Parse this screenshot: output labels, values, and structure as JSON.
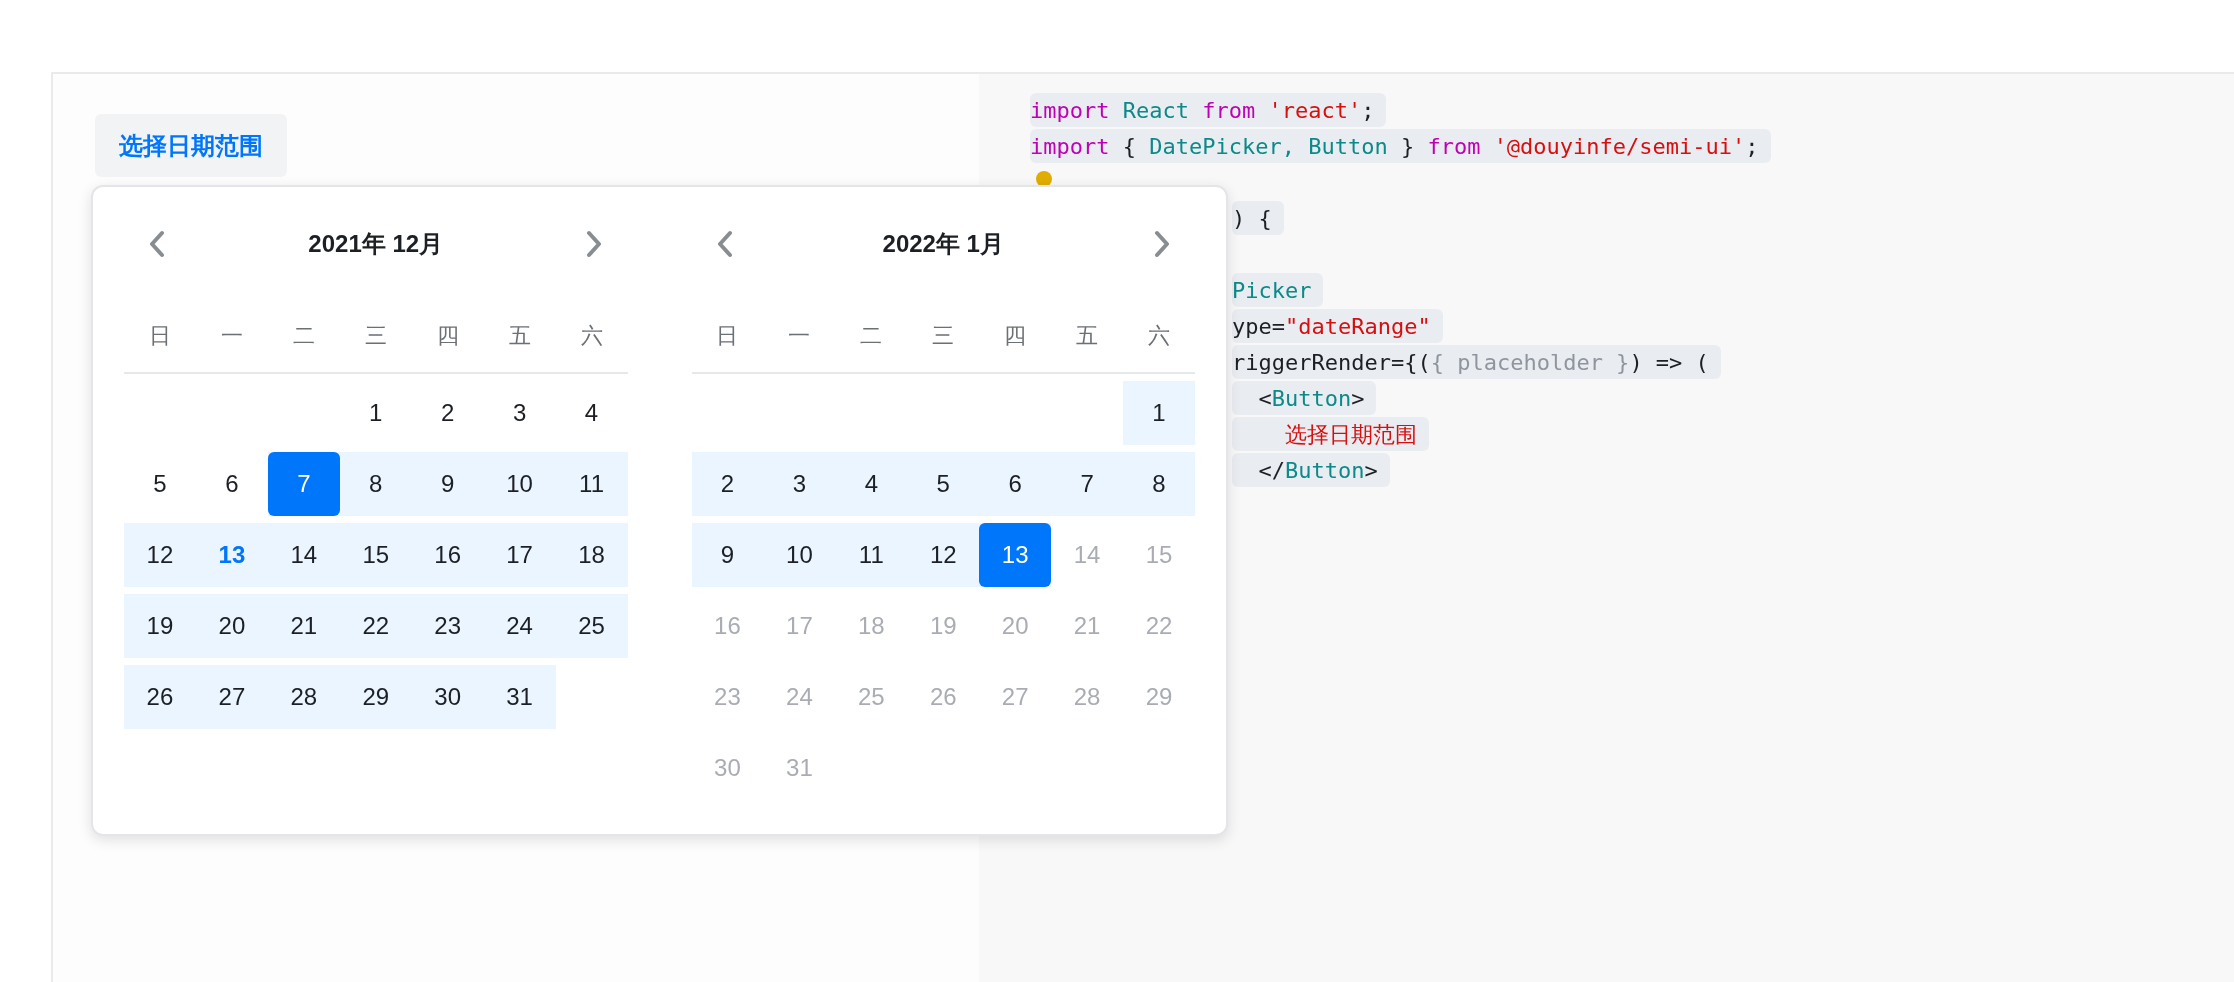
{
  "trigger_button": {
    "label": "选择日期范围"
  },
  "date_picker": {
    "months": [
      {
        "title": "2021年 12月",
        "weekdays": [
          "日",
          "一",
          "二",
          "三",
          "四",
          "五",
          "六"
        ],
        "weeks": [
          [
            {
              "d": "1",
              "selected": false,
              "in_range": false,
              "today": false,
              "disabled": false
            },
            {
              "d": "2",
              "selected": false,
              "in_range": false,
              "today": false,
              "disabled": false
            },
            {
              "d": "3",
              "selected": false,
              "in_range": false,
              "today": false,
              "disabled": false
            },
            {
              "d": "4",
              "selected": false,
              "in_range": false,
              "today": false,
              "disabled": false
            }
          ],
          [
            {
              "d": "5",
              "selected": false,
              "in_range": false,
              "today": false,
              "disabled": false
            },
            {
              "d": "6",
              "selected": false,
              "in_range": false,
              "today": false,
              "disabled": false
            },
            {
              "d": "7",
              "selected": true,
              "in_range": true,
              "today": false,
              "disabled": false
            },
            {
              "d": "8",
              "selected": false,
              "in_range": true,
              "today": false,
              "disabled": false
            },
            {
              "d": "9",
              "selected": false,
              "in_range": true,
              "today": false,
              "disabled": false
            },
            {
              "d": "10",
              "selected": false,
              "in_range": true,
              "today": false,
              "disabled": false
            },
            {
              "d": "11",
              "selected": false,
              "in_range": true,
              "today": false,
              "disabled": false
            }
          ],
          [
            {
              "d": "12",
              "selected": false,
              "in_range": true,
              "today": false,
              "disabled": false
            },
            {
              "d": "13",
              "selected": false,
              "in_range": true,
              "today": true,
              "disabled": false
            },
            {
              "d": "14",
              "selected": false,
              "in_range": true,
              "today": false,
              "disabled": false
            },
            {
              "d": "15",
              "selected": false,
              "in_range": true,
              "today": false,
              "disabled": false
            },
            {
              "d": "16",
              "selected": false,
              "in_range": true,
              "today": false,
              "disabled": false
            },
            {
              "d": "17",
              "selected": false,
              "in_range": true,
              "today": false,
              "disabled": false
            },
            {
              "d": "18",
              "selected": false,
              "in_range": true,
              "today": false,
              "disabled": false
            }
          ],
          [
            {
              "d": "19",
              "selected": false,
              "in_range": true,
              "today": false,
              "disabled": false
            },
            {
              "d": "20",
              "selected": false,
              "in_range": true,
              "today": false,
              "disabled": false
            },
            {
              "d": "21",
              "selected": false,
              "in_range": true,
              "today": false,
              "disabled": false
            },
            {
              "d": "22",
              "selected": false,
              "in_range": true,
              "today": false,
              "disabled": false
            },
            {
              "d": "23",
              "selected": false,
              "in_range": true,
              "today": false,
              "disabled": false
            },
            {
              "d": "24",
              "selected": false,
              "in_range": true,
              "today": false,
              "disabled": false
            },
            {
              "d": "25",
              "selected": false,
              "in_range": true,
              "today": false,
              "disabled": false
            }
          ],
          [
            {
              "d": "26",
              "selected": false,
              "in_range": true,
              "today": false,
              "disabled": false
            },
            {
              "d": "27",
              "selected": false,
              "in_range": true,
              "today": false,
              "disabled": false
            },
            {
              "d": "28",
              "selected": false,
              "in_range": true,
              "today": false,
              "disabled": false
            },
            {
              "d": "29",
              "selected": false,
              "in_range": true,
              "today": false,
              "disabled": false
            },
            {
              "d": "30",
              "selected": false,
              "in_range": true,
              "today": false,
              "disabled": false
            },
            {
              "d": "31",
              "selected": false,
              "in_range": true,
              "today": false,
              "disabled": false
            }
          ]
        ]
      },
      {
        "title": "2022年 1月",
        "weekdays": [
          "日",
          "一",
          "二",
          "三",
          "四",
          "五",
          "六"
        ],
        "weeks": [
          [
            {
              "d": "1",
              "selected": false,
              "in_range": true,
              "today": false,
              "disabled": false
            }
          ],
          [
            {
              "d": "2",
              "selected": false,
              "in_range": true,
              "today": false,
              "disabled": false
            },
            {
              "d": "3",
              "selected": false,
              "in_range": true,
              "today": false,
              "disabled": false
            },
            {
              "d": "4",
              "selected": false,
              "in_range": true,
              "today": false,
              "disabled": false
            },
            {
              "d": "5",
              "selected": false,
              "in_range": true,
              "today": false,
              "disabled": false
            },
            {
              "d": "6",
              "selected": false,
              "in_range": true,
              "today": false,
              "disabled": false
            },
            {
              "d": "7",
              "selected": false,
              "in_range": true,
              "today": false,
              "disabled": false
            },
            {
              "d": "8",
              "selected": false,
              "in_range": true,
              "today": false,
              "disabled": false
            }
          ],
          [
            {
              "d": "9",
              "selected": false,
              "in_range": true,
              "today": false,
              "disabled": false
            },
            {
              "d": "10",
              "selected": false,
              "in_range": true,
              "today": false,
              "disabled": false
            },
            {
              "d": "11",
              "selected": false,
              "in_range": true,
              "today": false,
              "disabled": false
            },
            {
              "d": "12",
              "selected": false,
              "in_range": true,
              "today": false,
              "disabled": false
            },
            {
              "d": "13",
              "selected": true,
              "in_range": true,
              "today": false,
              "disabled": false
            },
            {
              "d": "14",
              "selected": false,
              "in_range": false,
              "today": false,
              "disabled": true
            },
            {
              "d": "15",
              "selected": false,
              "in_range": false,
              "today": false,
              "disabled": true
            }
          ],
          [
            {
              "d": "16",
              "selected": false,
              "in_range": false,
              "today": false,
              "disabled": true
            },
            {
              "d": "17",
              "selected": false,
              "in_range": false,
              "today": false,
              "disabled": true
            },
            {
              "d": "18",
              "selected": false,
              "in_range": false,
              "today": false,
              "disabled": true
            },
            {
              "d": "19",
              "selected": false,
              "in_range": false,
              "today": false,
              "disabled": true
            },
            {
              "d": "20",
              "selected": false,
              "in_range": false,
              "today": false,
              "disabled": true
            },
            {
              "d": "21",
              "selected": false,
              "in_range": false,
              "today": false,
              "disabled": true
            },
            {
              "d": "22",
              "selected": false,
              "in_range": false,
              "today": false,
              "disabled": true
            }
          ],
          [
            {
              "d": "23",
              "selected": false,
              "in_range": false,
              "today": false,
              "disabled": true
            },
            {
              "d": "24",
              "selected": false,
              "in_range": false,
              "today": false,
              "disabled": true
            },
            {
              "d": "25",
              "selected": false,
              "in_range": false,
              "today": false,
              "disabled": true
            },
            {
              "d": "26",
              "selected": false,
              "in_range": false,
              "today": false,
              "disabled": true
            },
            {
              "d": "27",
              "selected": false,
              "in_range": false,
              "today": false,
              "disabled": true
            },
            {
              "d": "28",
              "selected": false,
              "in_range": false,
              "today": false,
              "disabled": true
            },
            {
              "d": "29",
              "selected": false,
              "in_range": false,
              "today": false,
              "disabled": true
            }
          ],
          [
            {
              "d": "30",
              "selected": false,
              "in_range": false,
              "today": false,
              "disabled": true
            },
            {
              "d": "31",
              "selected": false,
              "in_range": false,
              "today": false,
              "disabled": true
            }
          ]
        ]
      }
    ]
  },
  "code_editor": {
    "lines": [
      {
        "covered": false,
        "bulb": false,
        "tokens": [
          {
            "kind": "keyword",
            "t": "import "
          },
          {
            "kind": "ident",
            "t": "React "
          },
          {
            "kind": "keyword",
            "t": "from "
          },
          {
            "kind": "string",
            "t": "'react'"
          },
          {
            "kind": "plain",
            "t": ";"
          }
        ]
      },
      {
        "covered": false,
        "bulb": false,
        "tokens": [
          {
            "kind": "keyword",
            "t": "import "
          },
          {
            "kind": "plain",
            "t": "{ "
          },
          {
            "kind": "ident",
            "t": "DatePicker, Button "
          },
          {
            "kind": "plain",
            "t": "} "
          },
          {
            "kind": "keyword",
            "t": "from "
          },
          {
            "kind": "string",
            "t": "'@douyinfe/semi-ui'"
          },
          {
            "kind": "plain",
            "t": ";"
          }
        ]
      },
      {
        "covered": false,
        "bulb": true
      },
      {
        "covered": true,
        "bulb": false,
        "tokens": [
          {
            "kind": "plain",
            "t": ") {"
          }
        ]
      },
      {
        "bulb": false
      },
      {
        "covered": true,
        "bulb": false,
        "tokens": [
          {
            "kind": "ident",
            "t": "Picker"
          }
        ]
      },
      {
        "covered": true,
        "bulb": false,
        "tokens": [
          {
            "kind": "plain",
            "t": "ype="
          },
          {
            "kind": "string",
            "t": "\"dateRange\""
          }
        ]
      },
      {
        "covered": true,
        "bulb": false,
        "tokens": [
          {
            "kind": "plain",
            "t": "riggerRender={("
          },
          {
            "kind": "muted",
            "t": "{ placeholder }"
          },
          {
            "kind": "plain",
            "t": ") => ("
          }
        ]
      },
      {
        "covered": true,
        "bulb": false,
        "tokens": [
          {
            "kind": "plain",
            "t": "  <"
          },
          {
            "kind": "ident",
            "t": "Button"
          },
          {
            "kind": "plain",
            "t": ">"
          }
        ]
      },
      {
        "covered": true,
        "bulb": false,
        "tokens": [
          {
            "kind": "string",
            "t": "    选择日期范围"
          }
        ]
      },
      {
        "covered": true,
        "bulb": false,
        "tokens": [
          {
            "kind": "plain",
            "t": "  </"
          },
          {
            "kind": "ident",
            "t": "Button"
          },
          {
            "kind": "plain",
            "t": ">"
          }
        ]
      }
    ]
  }
}
